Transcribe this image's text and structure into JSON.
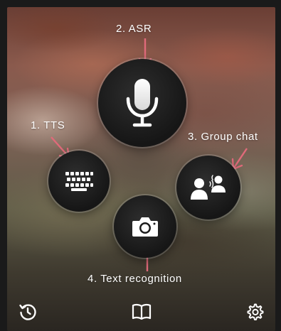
{
  "annotations": {
    "asr": "2. ASR",
    "tts": "1. TTS",
    "group_chat": "3. Group chat",
    "text_recognition": "4. Text recognition"
  },
  "colors": {
    "arrow": "#e06a7a",
    "button_bg": "#1b1b1b",
    "icon": "#ffffff"
  },
  "buttons": {
    "asr": "microphone-icon",
    "tts": "keyboard-icon",
    "group_chat": "group-chat-icon",
    "text_recognition": "camera-icon"
  },
  "bottom_bar": [
    "history-icon",
    "book-icon",
    "settings-icon"
  ]
}
